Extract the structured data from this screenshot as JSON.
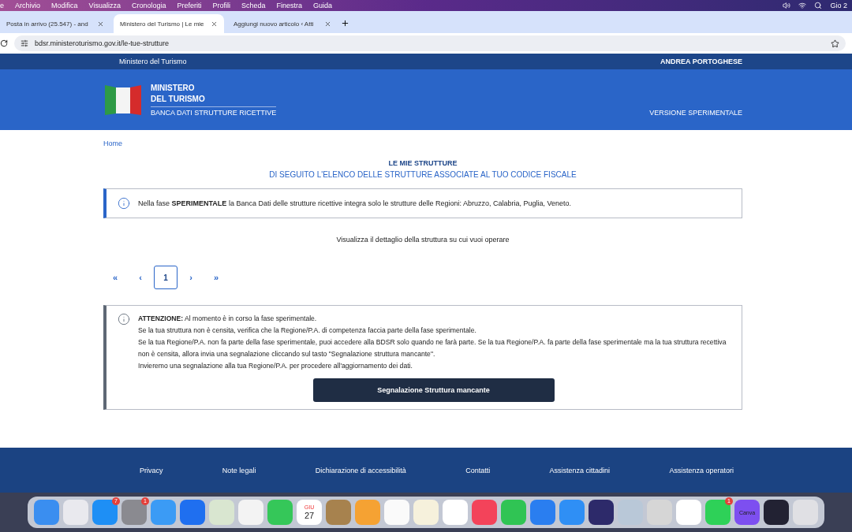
{
  "menu_bar": {
    "items": [
      "e",
      "Archivio",
      "Modifica",
      "Visualizza",
      "Cronologia",
      "Preferiti",
      "Profili",
      "Scheda",
      "Finestra",
      "Guida"
    ],
    "clock": "Gio 2"
  },
  "browser_tabs": [
    {
      "label": "Posta in arrivo (25.547) - and",
      "selected": false
    },
    {
      "label": "Ministero del Turismo | Le mie",
      "selected": true
    },
    {
      "label": "Aggiungi nuovo articolo ‹ Atti",
      "selected": false
    }
  ],
  "address_bar": {
    "url": "bdsr.ministeroturismo.gov.it/le-tue-strutture"
  },
  "top_bar": {
    "left": "Ministero del Turismo",
    "user": "ANDREA PORTOGHESE"
  },
  "header": {
    "title_line_1": "MINISTERO",
    "title_line_2": "DEL TURISMO",
    "subtitle": "BANCA DATI STRUTTURE RICETTIVE",
    "version": "VERSIONE SPERIMENTALE"
  },
  "breadcrumb": "Home",
  "page_title": "LE MIE STRUTTURE",
  "page_subtitle": "DI SEGUITO L'ELENCO DELLE STRUTTURE ASSOCIATE AL TUO CODICE FISCALE",
  "info_notice": "Nella fase **SPERIMENTALE** la Banca Dati delle strutture ricettive integra solo le strutture delle Regioni: Abruzzo, Calabria, Puglia, Veneto.",
  "instruction": "Visualizza il dettaglio della struttura su cui vuoi operare",
  "pagination": [
    {
      "label": "«",
      "kind": "nav",
      "selected": false
    },
    {
      "label": "‹",
      "kind": "nav",
      "selected": false
    },
    {
      "label": "1",
      "kind": "page",
      "selected": true
    },
    {
      "label": "›",
      "kind": "nav",
      "selected": false
    },
    {
      "label": "»",
      "kind": "nav",
      "selected": false
    }
  ],
  "warning": {
    "lines": [
      "**ATTENZIONE:** Al momento è in corso la fase sperimentale.",
      "Se la tua struttura non è censita, verifica che la Regione/P.A. di competenza faccia parte della fase sperimentale.",
      "Se la tua Regione/P.A. non fa parte della fase sperimentale, puoi accedere alla BDSR solo quando ne farà parte. Se la tua Regione/P.A. fa parte della fase sperimentale ma la tua struttura recettiva non è censita, allora invia una segnalazione cliccando sul tasto \"Segnalazione struttura mancante\".",
      "Invieremo una segnalazione alla tua Regione/P.A. per procedere all'aggiornamento dei dati."
    ],
    "button": "Segnalazione Struttura mancante"
  },
  "footer": {
    "links": [
      "Privacy",
      "Note legali",
      "Dichiarazione di accessibilità",
      "Contatti",
      "Assistenza cittadini",
      "Assistenza operatori"
    ]
  },
  "dock": [
    {
      "color": "#3a8ef0"
    },
    {
      "color": "#e9e9ee"
    },
    {
      "color": "#1e8ff5",
      "badge": "7"
    },
    {
      "color": "#8a8a90",
      "badge": "1"
    },
    {
      "color": "#3b9bf5"
    },
    {
      "color": "#1f6ff0"
    },
    {
      "color": "#d9e6d0"
    },
    {
      "color": "#f3f3f3"
    },
    {
      "color": "#35c759"
    },
    {
      "color": "#ffffff",
      "caption": "GIU",
      "label": "27"
    },
    {
      "color": "#a7824e"
    },
    {
      "color": "#f5a233"
    },
    {
      "color": "#fafafa"
    },
    {
      "color": "#f6f1dc"
    },
    {
      "color": "#ffffff"
    },
    {
      "color": "#f3435a"
    },
    {
      "color": "#30c454"
    },
    {
      "color": "#2a7ef0"
    },
    {
      "color": "#2f8ff5"
    },
    {
      "color": "#2d2a6a"
    },
    {
      "color": "#b9c8d8"
    },
    {
      "color": "#d6d6d6"
    },
    {
      "color": "#ffffff"
    },
    {
      "color": "#2ed158",
      "badge": "1"
    },
    {
      "color": "#7d4ff0",
      "label": "Canva"
    },
    {
      "color": "#222233"
    },
    {
      "color": "#e0e0e4"
    }
  ]
}
